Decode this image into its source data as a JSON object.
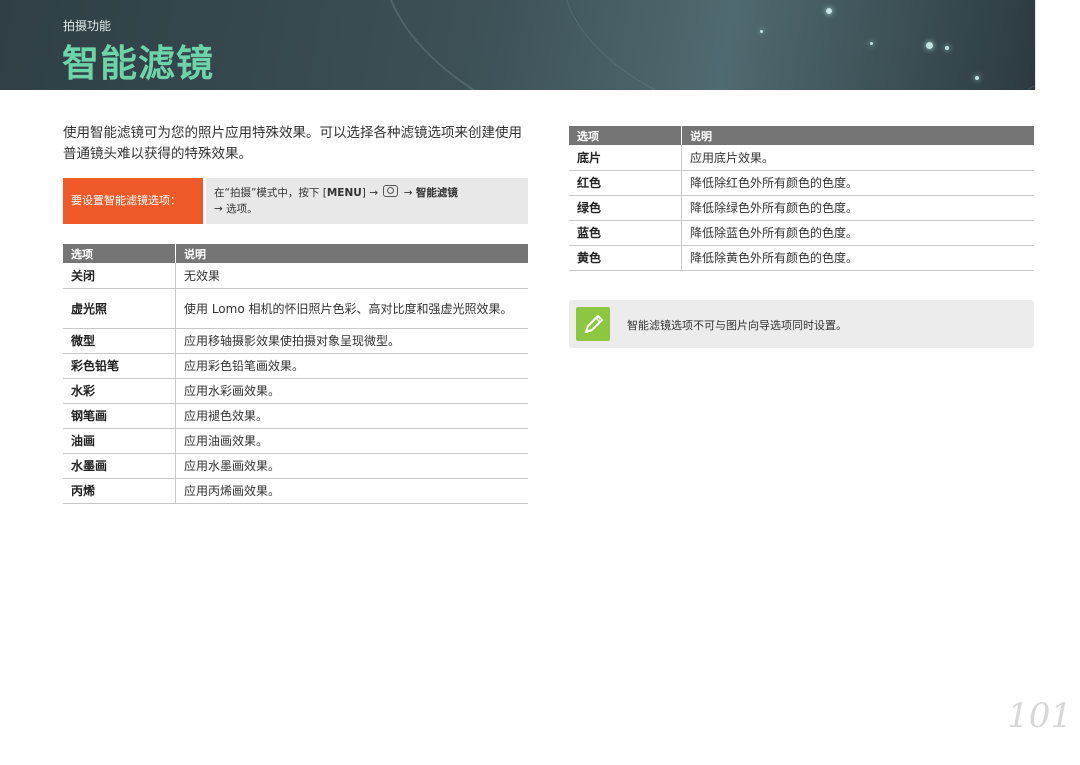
{
  "header": {
    "breadcrumb": "拍摄功能",
    "title": "智能滤镜"
  },
  "intro": "使用智能滤镜可为您的照片应用特殊效果。可以选择各种滤镜选项来创建使用普通镜头难以获得的特殊效果。",
  "howto": {
    "label": "要设置智能滤镜选项：",
    "line1_prefix": "在“拍摄”模式中，按下 [",
    "menu": "MENU",
    "arrow1": "] →",
    "arrow2": "→",
    "target": "智能滤镜",
    "line2": "→ 选项。"
  },
  "table_left": {
    "headers": [
      "选项",
      "说明"
    ],
    "rows": [
      {
        "name": "关闭",
        "desc": "无效果"
      },
      {
        "name": "虚光照",
        "desc": "使用 Lomo 相机的怀旧照片色彩、高对比度和强虚光照效果。"
      },
      {
        "name": "微型",
        "desc": "应用移轴摄影效果使拍摄对象呈现微型。"
      },
      {
        "name": "彩色铅笔",
        "desc": "应用彩色铅笔画效果。"
      },
      {
        "name": "水彩",
        "desc": "应用水彩画效果。"
      },
      {
        "name": "钢笔画",
        "desc": "应用褪色效果。"
      },
      {
        "name": "油画",
        "desc": "应用油画效果。"
      },
      {
        "name": "水墨画",
        "desc": "应用水墨画效果。"
      },
      {
        "name": "丙烯",
        "desc": "应用丙烯画效果。"
      }
    ]
  },
  "table_right": {
    "headers": [
      "选项",
      "说明"
    ],
    "rows": [
      {
        "name": "底片",
        "desc": "应用底片效果。"
      },
      {
        "name": "红色",
        "desc": "降低除红色外所有颜色的色度。"
      },
      {
        "name": "绿色",
        "desc": "降低除绿色外所有颜色的色度。"
      },
      {
        "name": "蓝色",
        "desc": "降低除蓝色外所有颜色的色度。"
      },
      {
        "name": "黄色",
        "desc": "降低除黄色外所有颜色的色度。"
      }
    ]
  },
  "note": {
    "icon": "pencil-note-icon",
    "text": "智能滤镜选项不可与图片向导选项同时设置。"
  },
  "page_number": "101",
  "colors": {
    "title": "#6fd3a9",
    "header_bg": "#3c5056",
    "howto_label": "#f05a28",
    "table_header": "#757575",
    "note_icon": "#8dc63f"
  }
}
